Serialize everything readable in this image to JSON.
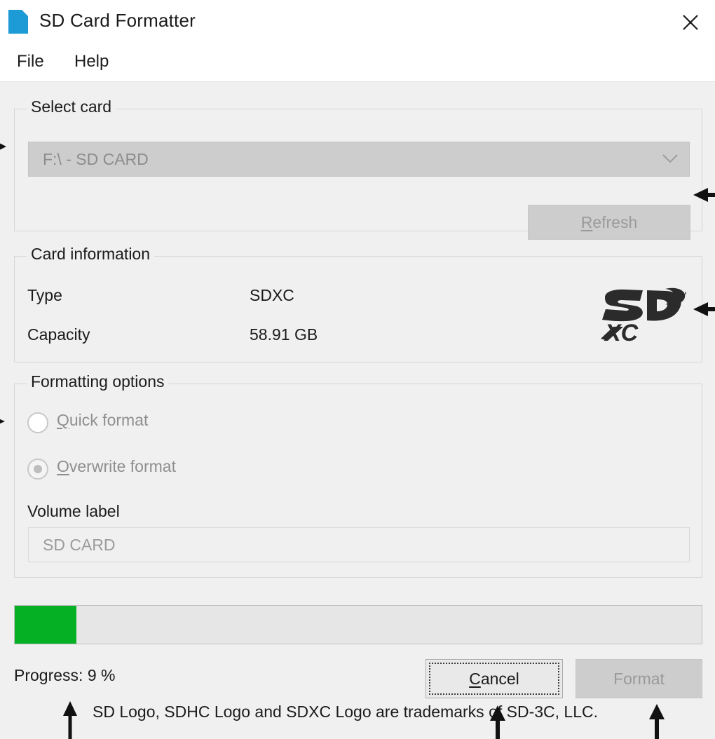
{
  "window": {
    "title": "SD Card Formatter",
    "icon": "sd-card-icon",
    "close_label": "✕",
    "background": "#f0f0f0"
  },
  "menubar": {
    "items": [
      {
        "label": "File"
      },
      {
        "label": "Help"
      }
    ]
  },
  "select_card": {
    "legend": "Select card",
    "combo": {
      "value": "F:\\ - SD CARD",
      "enabled": false,
      "arrow_icon": "chevron-down-icon"
    },
    "refresh_button": {
      "label": "Refresh",
      "accel": "R",
      "enabled": false
    }
  },
  "card_information": {
    "legend": "Card information",
    "rows": [
      {
        "label": "Type",
        "value": "SDXC"
      },
      {
        "label": "Capacity",
        "value": "58.91 GB"
      }
    ],
    "logo": {
      "name": "sdxc-logo",
      "top_text": "SD",
      "bottom_text": "XC",
      "trademark_mark": "™"
    }
  },
  "formatting_options": {
    "legend": "Formatting options",
    "radios": [
      {
        "label": "Quick format",
        "accel": "Q",
        "selected": false,
        "enabled": false
      },
      {
        "label": "Overwrite format",
        "accel": "O",
        "selected": true,
        "enabled": false
      }
    ],
    "volume_label": {
      "label": "Volume label",
      "value": "SD CARD",
      "enabled": false
    }
  },
  "progress": {
    "percent": 9,
    "text": "Progress: 9 %",
    "fill_color": "#06b025",
    "track_color": "#e6e6e6"
  },
  "actions": {
    "cancel_button": {
      "label": "Cancel",
      "accel": "C",
      "enabled": true,
      "focused": true
    },
    "format_button": {
      "label": "Format",
      "enabled": false
    }
  },
  "footer": {
    "trademark": "SD Logo, SDHC Logo and SDXC Logo are trademarks of SD-3C, LLC."
  },
  "annotations": {
    "arrows": [
      {
        "name": "arrow-to-card-combo",
        "direction": "right"
      },
      {
        "name": "arrow-to-refresh-button",
        "direction": "left"
      },
      {
        "name": "arrow-to-sdxc-logo",
        "direction": "left"
      },
      {
        "name": "arrow-to-quick-format-radio",
        "direction": "right"
      },
      {
        "name": "arrow-to-progress-text",
        "direction": "up"
      },
      {
        "name": "arrow-to-cancel-button",
        "direction": "up"
      },
      {
        "name": "arrow-to-format-button",
        "direction": "up"
      }
    ]
  }
}
